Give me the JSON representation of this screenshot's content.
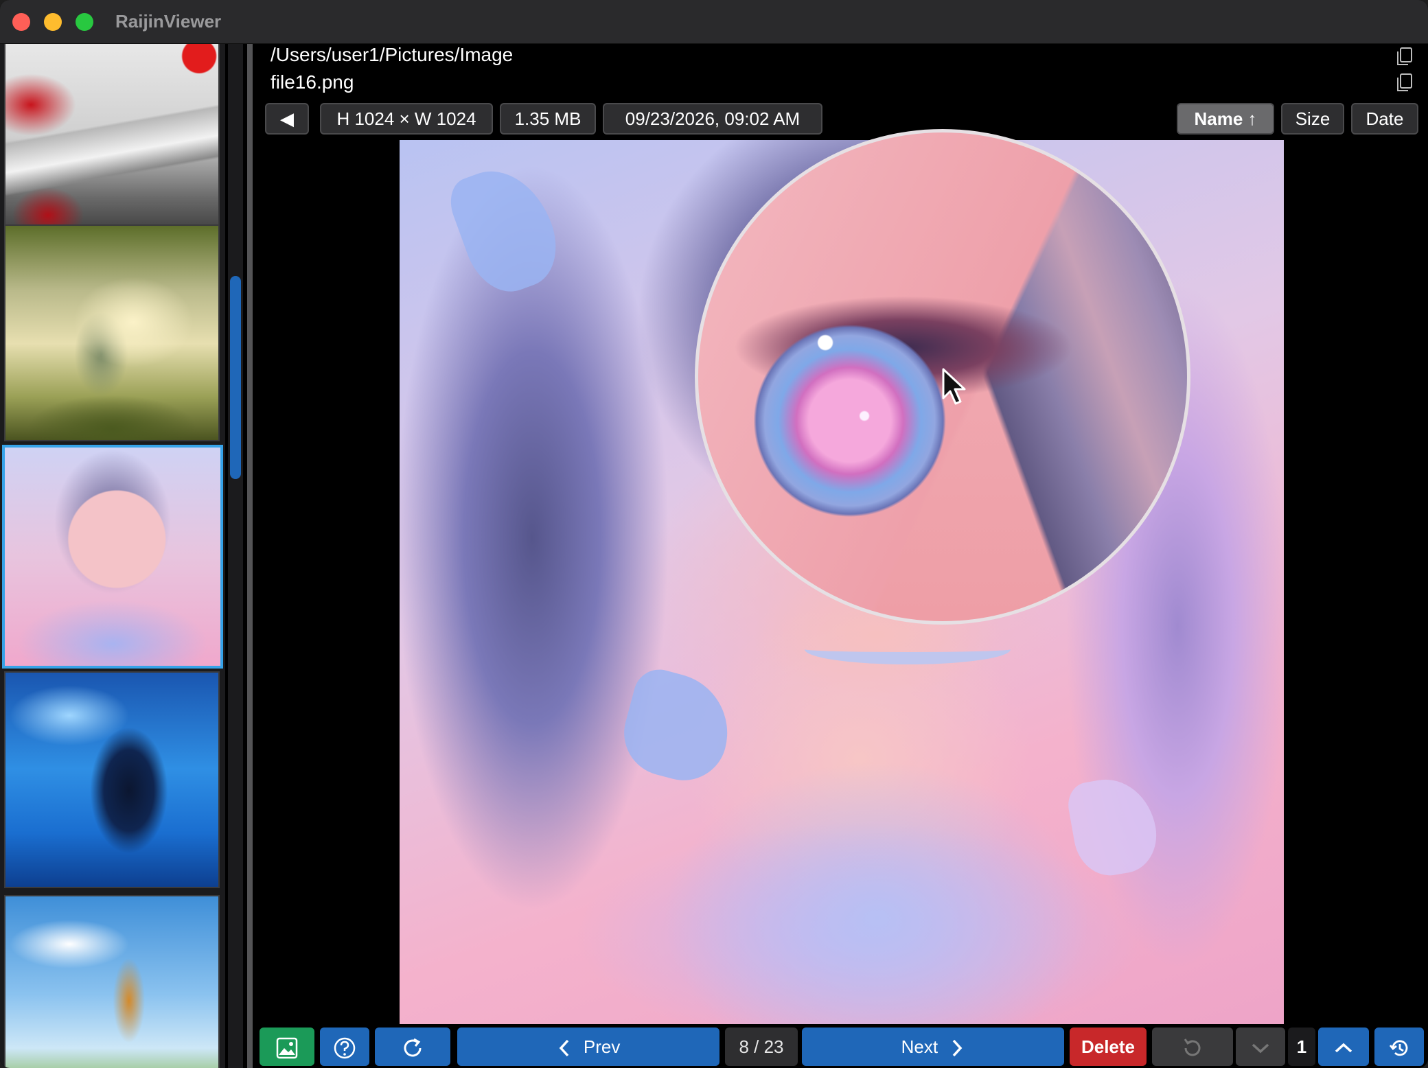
{
  "app": {
    "title": "RaijinViewer"
  },
  "file": {
    "path": "/Users/user1/Pictures/Image",
    "name": "file16.png",
    "dimensions": "H 1024 × W 1024",
    "size": "1.35 MB",
    "date": "09/23/2026, 09:02 AM"
  },
  "sort": {
    "name_label": "Name ↑",
    "size_label": "Size",
    "date_label": "Date",
    "active": "name"
  },
  "sidebar": {
    "thumbnails": [
      {
        "name": "thumb-mountain-lake"
      },
      {
        "name": "thumb-girl-meadow"
      },
      {
        "name": "thumb-girl-ribbons",
        "selected": true
      },
      {
        "name": "thumb-girl-blue-sky"
      },
      {
        "name": "thumb-girl-flower-field"
      }
    ]
  },
  "toolbar": {
    "prev_label": "Prev",
    "next_label": "Next",
    "counter": "8 / 23",
    "delete_label": "Delete",
    "page_number": "1"
  },
  "icons": {
    "back": "triangle-left-icon",
    "copy": "copy-icon",
    "gallery": "image-icon",
    "help": "question-circle-icon",
    "reload": "refresh-icon",
    "undo": "undo-icon",
    "history": "history-icon"
  },
  "colors": {
    "accent": "#1f67b8",
    "gallery": "#1b9a58",
    "danger": "#c8282a",
    "selection": "#36a3e8"
  }
}
